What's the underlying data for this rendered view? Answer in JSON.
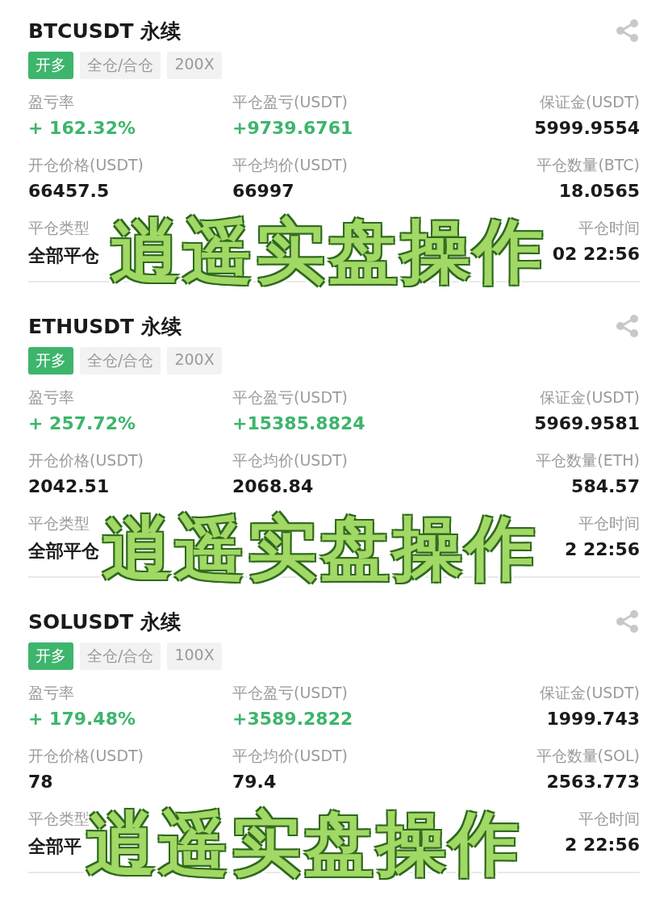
{
  "positions": [
    {
      "title": "BTCUSDT 永续",
      "tags": [
        {
          "text": "开多",
          "kind": "side"
        },
        {
          "text": "全仓/合仓",
          "kind": "plain"
        },
        {
          "text": "200X",
          "kind": "plain"
        }
      ],
      "fields": [
        {
          "kind": "field",
          "label": "盈亏率",
          "value": "+ 162.32%",
          "up": true
        },
        {
          "kind": "field",
          "label": "平仓盈亏(USDT)",
          "value": "+9739.6761",
          "up": true
        },
        {
          "kind": "field",
          "label": "保证金(USDT)",
          "value": "5999.9554",
          "up": false
        },
        {
          "kind": "field",
          "label": "开仓价格(USDT)",
          "value": "66457.5",
          "up": false
        },
        {
          "kind": "field",
          "label": "平仓均价(USDT)",
          "value": "66997",
          "up": false
        },
        {
          "kind": "field",
          "label": "平仓数量(BTC)",
          "value": "18.0565",
          "up": false
        },
        {
          "kind": "field",
          "label": "平仓类型",
          "value": "全部平仓",
          "up": false
        },
        {
          "kind": "blank"
        },
        {
          "kind": "field",
          "label": "平仓时间",
          "value": "02 22:56",
          "up": false
        }
      ],
      "overlay": "逍遥实盘操作"
    },
    {
      "title": "ETHUSDT 永续",
      "tags": [
        {
          "text": "开多",
          "kind": "side"
        },
        {
          "text": "全仓/合仓",
          "kind": "plain"
        },
        {
          "text": "200X",
          "kind": "plain"
        }
      ],
      "fields": [
        {
          "kind": "field",
          "label": "盈亏率",
          "value": "+ 257.72%",
          "up": true
        },
        {
          "kind": "field",
          "label": "平仓盈亏(USDT)",
          "value": "+15385.8824",
          "up": true
        },
        {
          "kind": "field",
          "label": "保证金(USDT)",
          "value": "5969.9581",
          "up": false
        },
        {
          "kind": "field",
          "label": "开仓价格(USDT)",
          "value": "2042.51",
          "up": false
        },
        {
          "kind": "field",
          "label": "平仓均价(USDT)",
          "value": "2068.84",
          "up": false
        },
        {
          "kind": "field",
          "label": "平仓数量(ETH)",
          "value": "584.57",
          "up": false
        },
        {
          "kind": "field",
          "label": "平仓类型",
          "value": "全部平仓",
          "up": false
        },
        {
          "kind": "blank"
        },
        {
          "kind": "field",
          "label": "平仓时间",
          "value": "2 22:56",
          "up": false
        }
      ],
      "overlay": "逍遥实盘操作"
    },
    {
      "title": "SOLUSDT 永续",
      "tags": [
        {
          "text": "开多",
          "kind": "side"
        },
        {
          "text": "全仓/合仓",
          "kind": "plain"
        },
        {
          "text": "100X",
          "kind": "plain"
        }
      ],
      "fields": [
        {
          "kind": "field",
          "label": "盈亏率",
          "value": "+ 179.48%",
          "up": true
        },
        {
          "kind": "field",
          "label": "平仓盈亏(USDT)",
          "value": "+3589.2822",
          "up": true
        },
        {
          "kind": "field",
          "label": "保证金(USDT)",
          "value": "1999.743",
          "up": false
        },
        {
          "kind": "field",
          "label": "开仓价格(USDT)",
          "value": "78",
          "up": false
        },
        {
          "kind": "field",
          "label": "平仓均价(USDT)",
          "value": "79.4",
          "up": false
        },
        {
          "kind": "field",
          "label": "平仓数量(SOL)",
          "value": "2563.773",
          "up": false
        },
        {
          "kind": "field",
          "label": "平仓类型",
          "value": "全部平",
          "up": false
        },
        {
          "kind": "blank"
        },
        {
          "kind": "field",
          "label": "平仓时间",
          "value": "2 22:56",
          "up": false
        }
      ],
      "overlay": "逍遥实盘操作"
    }
  ]
}
